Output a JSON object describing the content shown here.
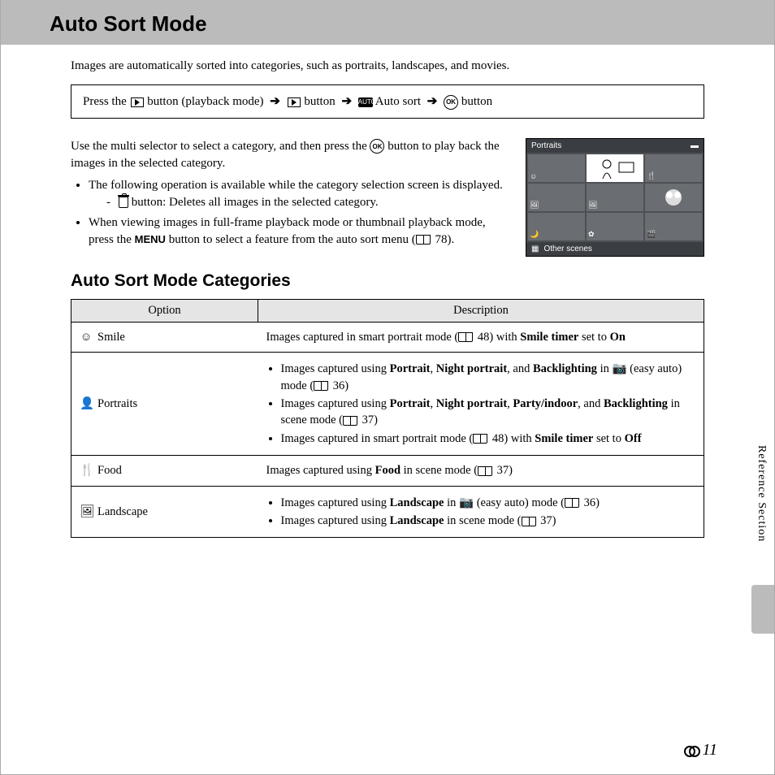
{
  "title": "Auto Sort Mode",
  "intro": "Images are automatically sorted into categories, such as portraits, landscapes, and movies.",
  "nav": {
    "press": "Press the",
    "button_playback": "button (playback mode)",
    "button": "button",
    "auto_sort": "Auto sort"
  },
  "instructions": {
    "p1a": "Use the multi selector to select a category, and then press the",
    "p1b": "button to play back the images in the selected category.",
    "li1": "The following operation is available while the category selection screen is displayed.",
    "sub1": "button: Deletes all images in the selected category.",
    "li2a": "When viewing images in full-frame playback mode or thumbnail playback mode, press the",
    "li2b": "button to select a feature from the auto sort menu (",
    "li2c": "78)."
  },
  "lcd": {
    "header": "Portraits",
    "footer": "Other scenes"
  },
  "subheading": "Auto Sort Mode Categories",
  "table": {
    "h1": "Option",
    "h2": "Description",
    "rows": [
      {
        "icon": "☺",
        "name": "Smile",
        "desc_pre": "Images captured in smart portrait mode (",
        "desc_ref": "48) with",
        "desc_bold": "Smile timer",
        "desc_post": "set to",
        "desc_bold2": "On"
      },
      {
        "icon": "👤",
        "name": "Portraits",
        "bullets": [
          {
            "parts": [
              "Images captured using ",
              "Portrait",
              ", ",
              "Night portrait",
              ", and ",
              "Backlighting",
              " in ",
              "📷",
              " (easy auto) mode (",
              "📖",
              " 36)"
            ]
          },
          {
            "parts": [
              "Images captured using ",
              "Portrait",
              ", ",
              "Night portrait",
              ", ",
              "Party/indoor",
              ", and ",
              "Backlighting",
              " in scene mode (",
              "📖",
              " 37)"
            ]
          },
          {
            "parts": [
              "Images captured in smart portrait mode (",
              "📖",
              " 48) with ",
              "Smile timer",
              " set to ",
              "Off"
            ]
          }
        ]
      },
      {
        "icon": "🍴",
        "name": "Food",
        "simple_pre": "Images captured using",
        "simple_bold": "Food",
        "simple_post": "in scene mode (",
        "simple_ref": "37)"
      },
      {
        "icon": "🖼",
        "name": "Landscape",
        "land": [
          {
            "parts": [
              "Images captured using ",
              "Landscape",
              " in ",
              "📷",
              " (easy auto) mode (",
              "📖",
              " 36)"
            ]
          },
          {
            "parts": [
              "Images captured using ",
              "Landscape",
              " in scene mode (",
              "📖",
              " 37)"
            ]
          }
        ]
      }
    ]
  },
  "side_label": "Reference Section",
  "page_num": "11"
}
